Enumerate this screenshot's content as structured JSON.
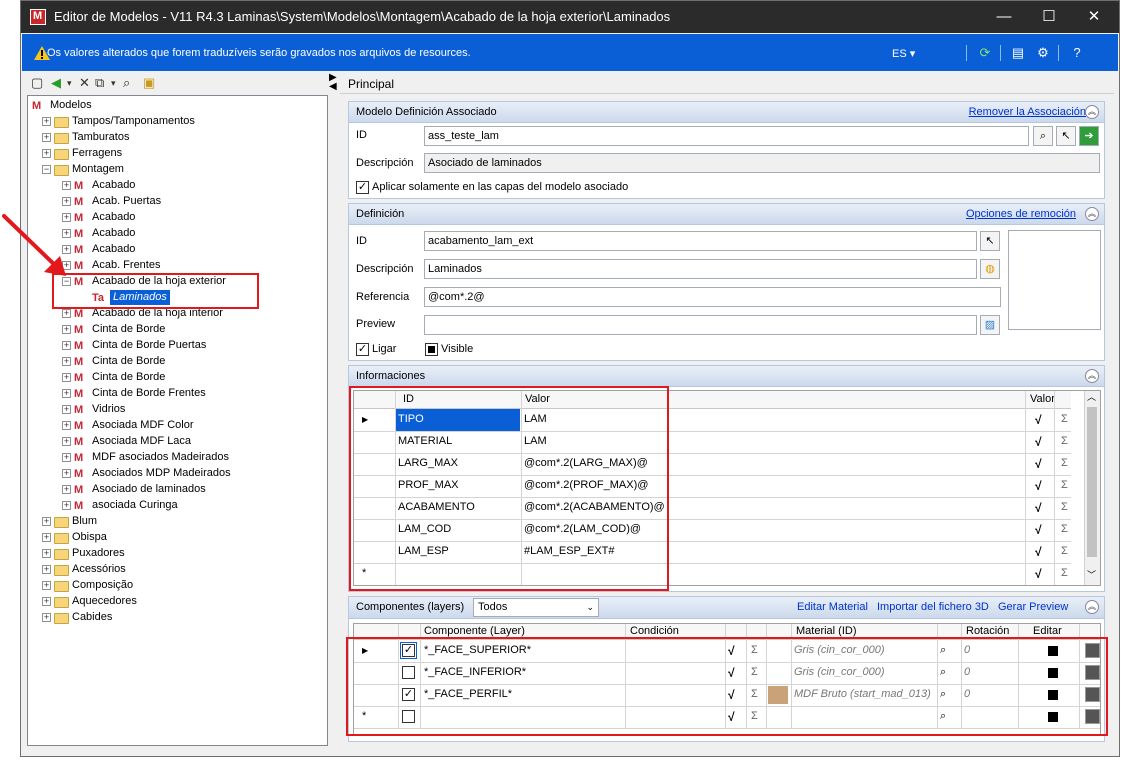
{
  "window": {
    "title": "Editor de Modelos - V11 R4.3 Laminas\\System\\Modelos\\Montagem\\Acabado de la hoja exterior\\Laminados",
    "minimize": "—",
    "maximize": "☐",
    "close": "✕"
  },
  "infobar": {
    "message": "Os valores alterados que forem traduzíveis serão gravados nos arquivos de resources.",
    "language": "ES ▾",
    "color": "#0a5fd6"
  },
  "tree": {
    "items": [
      {
        "label": "Modelos",
        "level": 0,
        "icon": "model-icon",
        "expander": ""
      },
      {
        "label": "Tampos/Tamponamentos",
        "level": 1,
        "icon": "folder-icon",
        "expander": "+"
      },
      {
        "label": "Tamburatos",
        "level": 1,
        "icon": "folder-icon",
        "expander": "+"
      },
      {
        "label": "Ferragens",
        "level": 1,
        "icon": "folder-icon",
        "expander": "+"
      },
      {
        "label": "Montagem",
        "level": 1,
        "icon": "folder-icon",
        "expander": "−"
      },
      {
        "label": "Acabado",
        "level": 2,
        "icon": "model-icon",
        "expander": "+"
      },
      {
        "label": "Acab. Puertas",
        "level": 2,
        "icon": "model-icon",
        "expander": "+"
      },
      {
        "label": "Acabado",
        "level": 2,
        "icon": "model-icon",
        "expander": "+"
      },
      {
        "label": "Acabado",
        "level": 2,
        "icon": "model-icon",
        "expander": "+"
      },
      {
        "label": "Acabado",
        "level": 2,
        "icon": "model-icon",
        "expander": "+"
      },
      {
        "label": "Acab. Frentes",
        "level": 2,
        "icon": "model-icon",
        "expander": "+"
      },
      {
        "label": "Acabado de la hoja exterior",
        "level": 2,
        "icon": "model-icon",
        "expander": "−"
      },
      {
        "label": "Laminados",
        "level": 3,
        "icon": "text-model-icon",
        "expander": "",
        "selected": true
      },
      {
        "label": "Acabado de la hoja interior",
        "level": 2,
        "icon": "model-icon",
        "expander": "+"
      },
      {
        "label": "Cinta de Borde",
        "level": 2,
        "icon": "model-icon",
        "expander": "+"
      },
      {
        "label": "Cinta de Borde Puertas",
        "level": 2,
        "icon": "model-icon",
        "expander": "+"
      },
      {
        "label": "Cinta de Borde",
        "level": 2,
        "icon": "model-icon",
        "expander": "+"
      },
      {
        "label": "Cinta de Borde",
        "level": 2,
        "icon": "model-icon",
        "expander": "+"
      },
      {
        "label": "Cinta de Borde Frentes",
        "level": 2,
        "icon": "model-icon",
        "expander": "+"
      },
      {
        "label": "Vidrios",
        "level": 2,
        "icon": "model-icon",
        "expander": "+"
      },
      {
        "label": "Asociada MDF Color",
        "level": 2,
        "icon": "model-icon",
        "expander": "+"
      },
      {
        "label": "Asociada MDF Laca",
        "level": 2,
        "icon": "model-icon",
        "expander": "+"
      },
      {
        "label": "MDF asociados Madeirados",
        "level": 2,
        "icon": "model-icon",
        "expander": "+"
      },
      {
        "label": "Asociados MDP Madeirados",
        "level": 2,
        "icon": "model-icon",
        "expander": "+"
      },
      {
        "label": "Asociado de laminados",
        "level": 2,
        "icon": "model-icon",
        "expander": "+"
      },
      {
        "label": "asociada Curinga",
        "level": 2,
        "icon": "model-icon",
        "expander": "+"
      },
      {
        "label": "Blum",
        "level": 1,
        "icon": "folder-icon",
        "expander": "+"
      },
      {
        "label": "Obispa",
        "level": 1,
        "icon": "folder-icon",
        "expander": "+"
      },
      {
        "label": "Puxadores",
        "level": 1,
        "icon": "folder-icon",
        "expander": "+"
      },
      {
        "label": "Acessórios",
        "level": 1,
        "icon": "folder-icon",
        "expander": "+"
      },
      {
        "label": "Composição",
        "level": 1,
        "icon": "folder-icon",
        "expander": "+"
      },
      {
        "label": "Aquecedores",
        "level": 1,
        "icon": "folder-icon",
        "expander": "+"
      },
      {
        "label": "Cabides",
        "level": 1,
        "icon": "folder-icon",
        "expander": "+"
      }
    ]
  },
  "main": {
    "header": "Principal",
    "associated": {
      "title": "Modelo Definición Associado",
      "remove_link": "Remover la Associación",
      "id_label": "ID",
      "id_value": "ass_teste_lam",
      "desc_label": "Descripción",
      "desc_value": "Asociado de laminados",
      "apply_label": "Aplicar solamente en las capas del modelo asociado"
    },
    "definition": {
      "title": "Definición",
      "remove_options_link": "Opciones de remoción",
      "id_label": "ID",
      "id_value": "acabamento_lam_ext",
      "desc_label": "Descripción",
      "desc_value": "Laminados",
      "ref_label": "Referencia",
      "ref_value": "@com*.2@",
      "preview_label": "Preview",
      "preview_value": "",
      "ligar_label": "Ligar",
      "visible_label": "Visible"
    },
    "informaciones": {
      "title": "Informaciones",
      "col_id": "ID",
      "col_valor": "Valor",
      "col_valor2": "Valor",
      "rows": [
        {
          "id": "TIPO",
          "valor": "LAM"
        },
        {
          "id": "MATERIAL",
          "valor": "LAM"
        },
        {
          "id": "LARG_MAX",
          "valor": "@com*.2(LARG_MAX)@"
        },
        {
          "id": "PROF_MAX",
          "valor": "@com*.2(PROF_MAX)@"
        },
        {
          "id": "ACABAMENTO",
          "valor": "@com*.2(ACABAMENTO)@"
        },
        {
          "id": "LAM_COD",
          "valor": "@com*.2(LAM_COD)@"
        },
        {
          "id": "LAM_ESP",
          "valor": "#LAM_ESP_EXT#"
        }
      ],
      "new_row_marker": "*"
    },
    "components": {
      "title": "Componentes (layers)",
      "filter_value": "Todos",
      "link_edit_material": "Editar Material",
      "link_import": "Importar del fichero 3D",
      "link_preview": "Gerar Preview",
      "col_component": "Componente (Layer)",
      "col_condition": "Condición",
      "col_material": "Material (ID)",
      "col_rotation": "Rotación",
      "col_edit": "Editar",
      "rows": [
        {
          "checked": "✓",
          "component": "*_FACE_SUPERIOR*",
          "material": "Gris (cin_cor_000)",
          "rotation": "0"
        },
        {
          "checked": "",
          "component": "*_FACE_INFERIOR*",
          "material": "Gris (cin_cor_000)",
          "rotation": "0"
        },
        {
          "checked": "✓",
          "component": "*_FACE_PERFIL*",
          "material": "MDF Bruto (start_mad_013)",
          "rotation": "0"
        }
      ],
      "new_row_marker": "*"
    }
  }
}
